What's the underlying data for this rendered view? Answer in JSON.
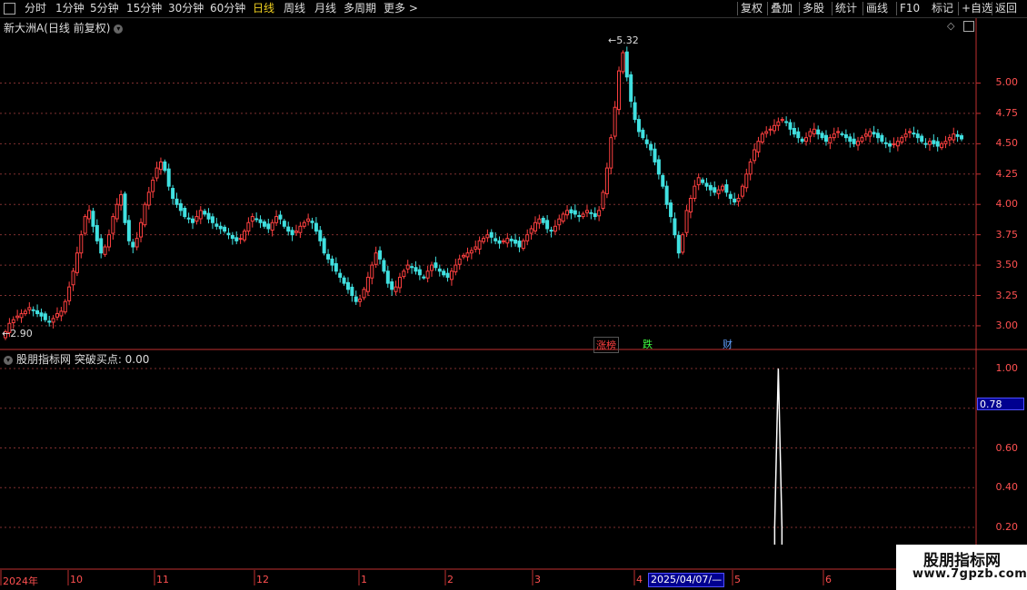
{
  "toolbar": {
    "periods": [
      "分时",
      "1分钟",
      "5分钟",
      "15分钟",
      "30分钟",
      "60分钟",
      "日线",
      "周线",
      "月线",
      "多周期",
      "更多 >"
    ],
    "active_period": "日线",
    "right_buttons": [
      "复权",
      "叠加",
      "多股",
      "统计",
      "画线",
      "F10",
      "+自选",
      "返回"
    ],
    "right_extra": "标记"
  },
  "main_panel": {
    "title": "新大洲A(日线 前复权)",
    "high_label": "5.32",
    "low_label": "2.90",
    "y_ticks": [
      "5.00",
      "4.75",
      "4.50",
      "4.25",
      "4.00",
      "3.75",
      "3.50",
      "3.25",
      "3.00"
    ],
    "tags": [
      {
        "text": "涨榜",
        "color": "#ff4040"
      },
      {
        "text": "跌",
        "color": "#40ff40"
      },
      {
        "text": "财",
        "color": "#60a0ff"
      }
    ]
  },
  "indicator_panel": {
    "title": "股朋指标网 突破买点: 0.00",
    "y_ticks": [
      "1.00",
      "0.60",
      "0.40",
      "0.20"
    ],
    "current_value": "0.78"
  },
  "x_axis": {
    "labels": [
      "2024年",
      "10",
      "11",
      "12",
      "1",
      "2",
      "3",
      "4",
      "5",
      "6"
    ],
    "highlight": "2025/04/07/—"
  },
  "watermark": {
    "line1": "股朋指标网",
    "line2": "www.7gpzb.com"
  },
  "chart_data": {
    "type": "candlestick",
    "price_ylim": [
      2.82,
      5.4
    ],
    "signal_ylim": [
      0.1,
      1.0
    ],
    "signal_series": {
      "name": "突破买点",
      "peak": 1.0,
      "peak_bar_index": 194
    },
    "closes": [
      2.95,
      3.02,
      3.05,
      3.08,
      3.1,
      3.12,
      3.15,
      3.13,
      3.1,
      3.08,
      3.05,
      3.03,
      3.06,
      3.1,
      3.12,
      3.2,
      3.32,
      3.45,
      3.6,
      3.75,
      3.9,
      3.95,
      3.82,
      3.7,
      3.6,
      3.65,
      3.75,
      3.9,
      4.0,
      4.08,
      3.85,
      3.7,
      3.65,
      3.72,
      3.85,
      4.0,
      4.1,
      4.2,
      4.3,
      4.35,
      4.28,
      4.15,
      4.05,
      4.0,
      3.95,
      3.9,
      3.88,
      3.85,
      3.9,
      3.95,
      3.92,
      3.88,
      3.85,
      3.82,
      3.8,
      3.78,
      3.75,
      3.72,
      3.7,
      3.72,
      3.78,
      3.85,
      3.9,
      3.88,
      3.85,
      3.82,
      3.8,
      3.85,
      3.9,
      3.88,
      3.82,
      3.78,
      3.75,
      3.78,
      3.82,
      3.85,
      3.88,
      3.85,
      3.78,
      3.7,
      3.6,
      3.55,
      3.5,
      3.45,
      3.4,
      3.35,
      3.3,
      3.25,
      3.2,
      3.22,
      3.3,
      3.4,
      3.5,
      3.6,
      3.55,
      3.45,
      3.35,
      3.3,
      3.32,
      3.4,
      3.45,
      3.5,
      3.48,
      3.45,
      3.42,
      3.4,
      3.45,
      3.5,
      3.48,
      3.45,
      3.42,
      3.4,
      3.45,
      3.5,
      3.55,
      3.58,
      3.6,
      3.62,
      3.65,
      3.7,
      3.72,
      3.75,
      3.73,
      3.7,
      3.68,
      3.7,
      3.72,
      3.7,
      3.68,
      3.65,
      3.7,
      3.75,
      3.8,
      3.85,
      3.88,
      3.85,
      3.8,
      3.78,
      3.82,
      3.88,
      3.92,
      3.95,
      3.93,
      3.92,
      3.9,
      3.92,
      3.95,
      3.93,
      3.9,
      3.95,
      4.1,
      4.3,
      4.55,
      4.8,
      5.1,
      5.25,
      5.05,
      4.85,
      4.7,
      4.6,
      4.55,
      4.5,
      4.45,
      4.35,
      4.25,
      4.15,
      4.0,
      3.9,
      3.75,
      3.6,
      3.75,
      3.95,
      4.05,
      4.15,
      4.22,
      4.18,
      4.15,
      4.12,
      4.1,
      4.12,
      4.15,
      4.1,
      4.05,
      4.02,
      4.05,
      4.15,
      4.25,
      4.35,
      4.45,
      4.52,
      4.58,
      4.6,
      4.62,
      4.65,
      4.68,
      4.7,
      4.68,
      4.62,
      4.58,
      4.55,
      4.52,
      4.55,
      4.6,
      4.62,
      4.58,
      4.55,
      4.52,
      4.55,
      4.58,
      4.6,
      4.58,
      4.55,
      4.52,
      4.5,
      4.52,
      4.55,
      4.58,
      4.6,
      4.58,
      4.55,
      4.52,
      4.5,
      4.48,
      4.5,
      4.52,
      4.55,
      4.58,
      4.6,
      4.58,
      4.55,
      4.52,
      4.5,
      4.52,
      4.5,
      4.48,
      4.5,
      4.52,
      4.55,
      4.58,
      4.56,
      4.54
    ]
  }
}
